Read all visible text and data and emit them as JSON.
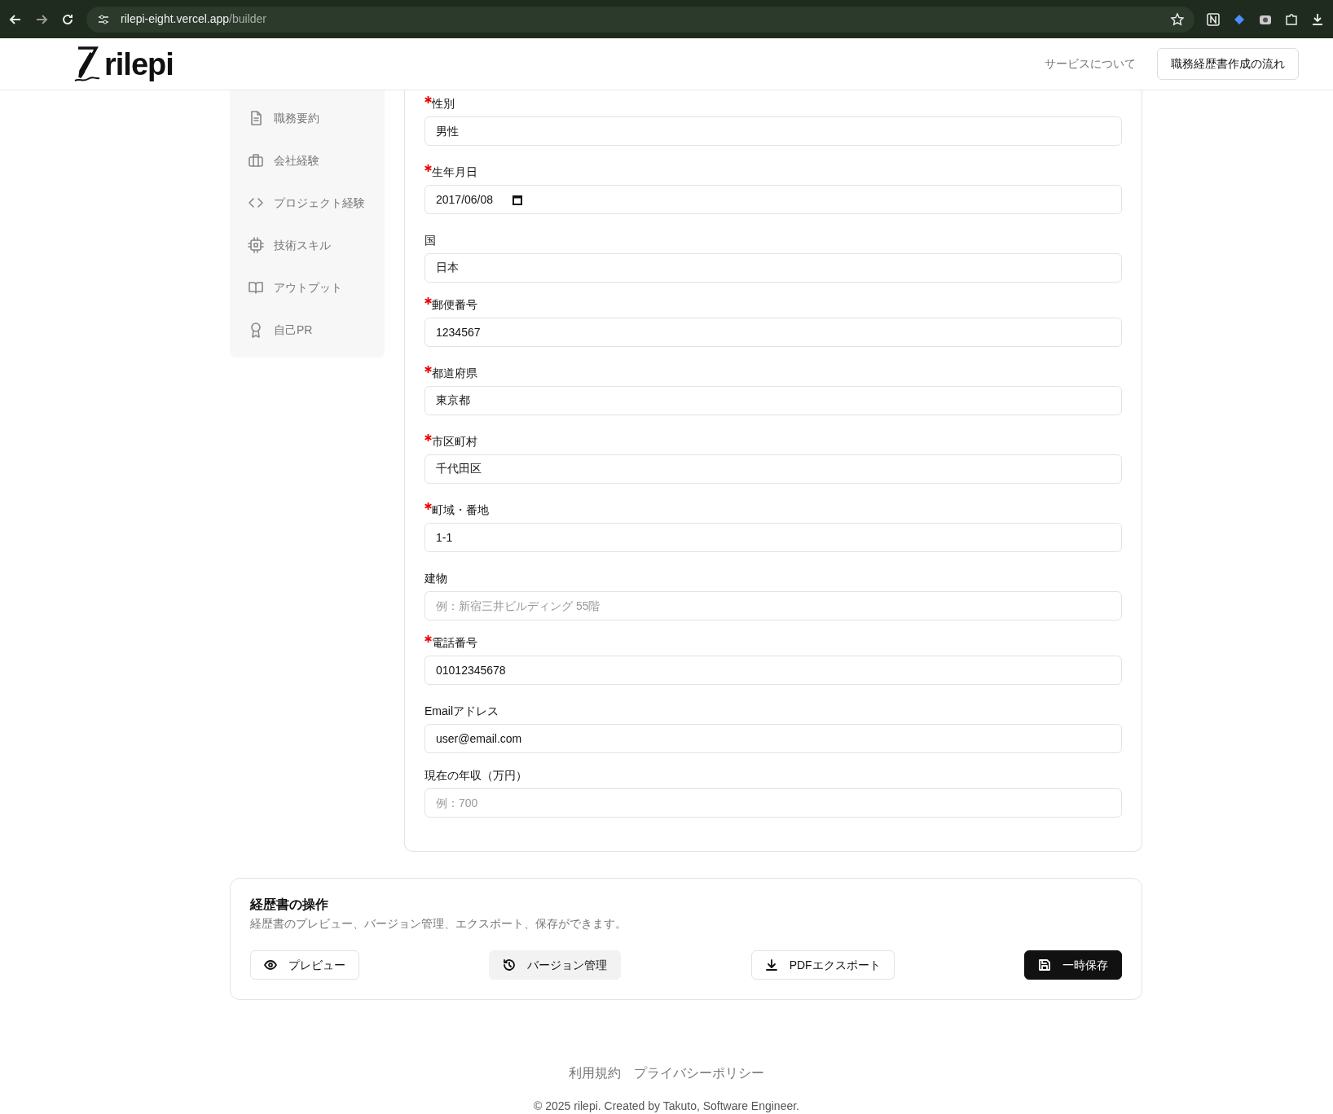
{
  "browser": {
    "url_host": "rilepi-eight.vercel.app",
    "url_path": "/builder"
  },
  "header": {
    "logo": "rilepi",
    "links": [
      {
        "label": "サービスについて",
        "kind": "plain"
      },
      {
        "label": "職務経歴書作成の流れ",
        "kind": "outline"
      }
    ]
  },
  "sidebar": {
    "items": [
      {
        "label": "職務要約"
      },
      {
        "label": "会社経験"
      },
      {
        "label": "プロジェクト経験"
      },
      {
        "label": "技術スキル"
      },
      {
        "label": "アウトプット"
      },
      {
        "label": "自己PR"
      }
    ]
  },
  "form": {
    "fields": [
      {
        "label": "性別",
        "required": true,
        "kind": "select",
        "value": "男性"
      },
      {
        "label": "生年月日",
        "required": true,
        "kind": "date",
        "value": "2017/06/08"
      },
      {
        "label": "国",
        "required": false,
        "kind": "text",
        "value": "日本"
      },
      {
        "label": "郵便番号",
        "required": true,
        "kind": "text",
        "value": "1234567"
      },
      {
        "label": "都道府県",
        "required": true,
        "kind": "text",
        "value": "東京都"
      },
      {
        "label": "市区町村",
        "required": true,
        "kind": "text",
        "value": "千代田区"
      },
      {
        "label": "町域・番地",
        "required": true,
        "kind": "text",
        "value": "1-1"
      },
      {
        "label": "建物",
        "required": false,
        "kind": "text",
        "placeholder": "例：新宿三井ビルディング 55階"
      },
      {
        "label": "電話番号",
        "required": true,
        "kind": "text",
        "value": "01012345678"
      },
      {
        "label": "Emailアドレス",
        "required": false,
        "kind": "text",
        "value": "user@email.com"
      },
      {
        "label": "現在の年収（万円）",
        "required": false,
        "kind": "text",
        "placeholder": "例：700"
      }
    ]
  },
  "actions": {
    "title": "経歴書の操作",
    "description": "経歴書のプレビュー、バージョン管理、エクスポート、保存ができます。",
    "buttons": [
      {
        "label": "プレビュー",
        "kind": "outline"
      },
      {
        "label": "バージョン管理",
        "kind": "ghost"
      },
      {
        "label": "PDFエクスポート",
        "kind": "outline"
      },
      {
        "label": "一時保存",
        "kind": "dark"
      }
    ]
  },
  "footer": {
    "links": [
      "利用規約",
      "プライバシーポリシー"
    ],
    "copyright": "© 2025 rilepi. Created by Takuto, Software Engineer."
  }
}
